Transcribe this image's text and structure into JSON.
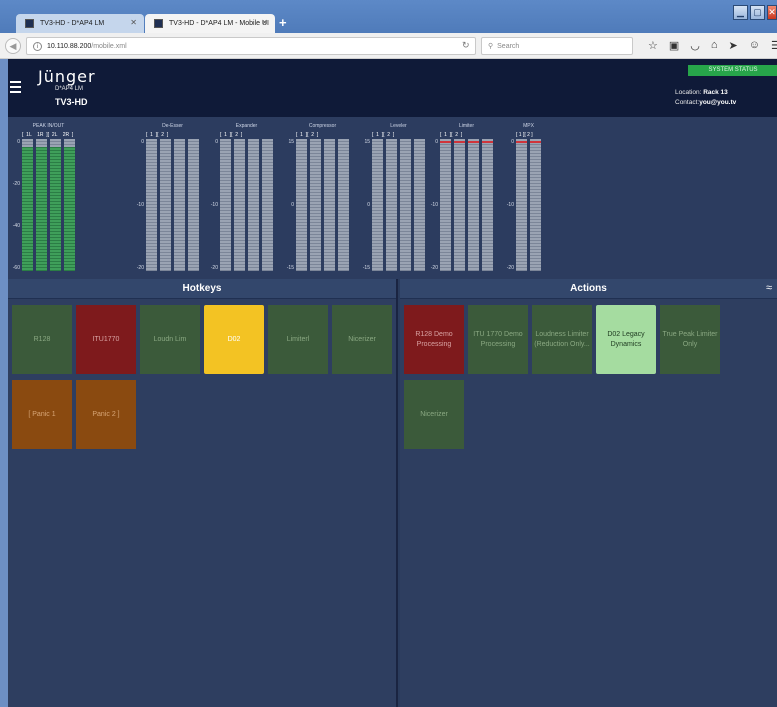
{
  "browser": {
    "tabs": [
      {
        "label": "TV3-HD - D*AP4 LM",
        "active": false
      },
      {
        "label": "TV3-HD - D*AP4 LM - Mobile UI",
        "active": true
      }
    ],
    "new_tab": "+",
    "url_host": "10.110.88.200",
    "url_path": "/mobile.xml",
    "search_placeholder": "Search",
    "icons": [
      "star-icon",
      "clipboard-icon",
      "pocket-icon",
      "home-icon",
      "send-icon",
      "chat-icon",
      "menu-icon"
    ]
  },
  "header": {
    "logo": "Jünger",
    "model": "D*AP4 LM",
    "device": "TV3-HD",
    "system_status": "SYSTEM STATUS",
    "location_label": "Location:",
    "location_value": "Rack 13",
    "contact_label": "Contact:",
    "contact_value": "you@you.tv"
  },
  "meters": [
    {
      "title": "PEAK IN/OUT",
      "channels": "[  1L    1R  ][  2L    2R  ]",
      "scale": [
        "0",
        "-20",
        "-40",
        "-60"
      ],
      "bars": 4,
      "green": true
    },
    {
      "title": "De-Esser",
      "channels": "[  1  ][  2  ]",
      "scale": [
        "0",
        "-10",
        "-20"
      ],
      "bars": 4,
      "green": false
    },
    {
      "title": "Expander",
      "channels": "[  1  ][  2  ]",
      "scale": [
        "0",
        "-10",
        "-20"
      ],
      "bars": 4,
      "green": false
    },
    {
      "title": "Compressor",
      "channels": "[  1  ][  2  ]",
      "scale": [
        "15",
        "0",
        "-15"
      ],
      "bars": 4,
      "green": false
    },
    {
      "title": "Leveler",
      "channels": "[  1  ][  2  ]",
      "scale": [
        "15",
        "0",
        "-15"
      ],
      "bars": 4,
      "green": false
    },
    {
      "title": "Limiter",
      "channels": "[  1  ][  2  ]",
      "scale": [
        "0",
        "-10",
        "-20"
      ],
      "bars": 4,
      "green": false,
      "redmark": true
    },
    {
      "title": "MPX",
      "channels": "[ 1 ][ 2 ]",
      "scale": [
        "0",
        "-10",
        "-20"
      ],
      "bars": 2,
      "green": false,
      "redmark": true
    }
  ],
  "hotkeys": {
    "title": "Hotkeys",
    "items": [
      {
        "label": "R128",
        "style": "dk"
      },
      {
        "label": "ITU1770",
        "style": "red"
      },
      {
        "label": "Loudn Lim",
        "style": "dk"
      },
      {
        "label": "D02",
        "style": "yel"
      },
      {
        "label": "Limiterl",
        "style": "dk"
      },
      {
        "label": "Nicerizer",
        "style": "dk"
      },
      {
        "label": "[ Panic 1",
        "style": "org"
      },
      {
        "label": "Panic 2 ]",
        "style": "org"
      }
    ]
  },
  "actions": {
    "title": "Actions",
    "items": [
      {
        "label": "R128 Demo Processing",
        "style": "red"
      },
      {
        "label": "ITU 1770 Demo Processing",
        "style": "dk"
      },
      {
        "label": "Loudness Limiter (Reduction Only...",
        "style": "dk"
      },
      {
        "label": "D02 Legacy Dynamics",
        "style": "ltg"
      },
      {
        "label": "True Peak Limiter Only",
        "style": "dk"
      },
      {
        "label": "Nicerizer",
        "style": "dk"
      }
    ]
  }
}
